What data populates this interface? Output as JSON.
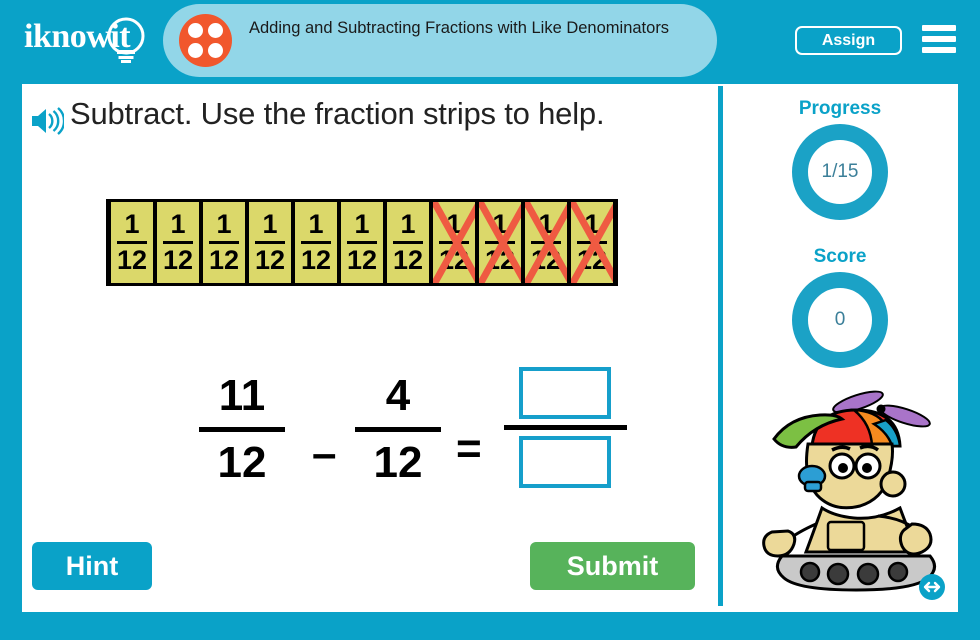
{
  "header": {
    "logo_text": "iknowit",
    "logo_icon": "lightbulb-icon",
    "title": "Adding and Subtracting Fractions with Like Denominators",
    "title_icon": "four-dots-circle-icon",
    "assign_label": "Assign",
    "menu_icon": "hamburger-menu-icon",
    "bg_color": "#0aa2c8",
    "panel_color": "#92d6e8",
    "accent_orange": "#f1572c"
  },
  "main": {
    "audio_icon": "speaker-icon",
    "question": "Subtract. Use the fraction strips to help.",
    "strips": {
      "label_numerator": "1",
      "label_denominator": "12",
      "total": 11,
      "crossed_out": 4,
      "fill_color": "#dbd86a",
      "cross_color": "#ef5a42"
    },
    "equation": {
      "first": {
        "numerator": "11",
        "denominator": "12"
      },
      "operator": "–",
      "second": {
        "numerator": "4",
        "denominator": "12"
      },
      "equals": "=",
      "answer": {
        "numerator": "",
        "denominator": ""
      },
      "answer_border_color": "#169fcb"
    },
    "hint_label": "Hint",
    "submit_label": "Submit",
    "hint_color": "#0aa2c8",
    "submit_color": "#57b35b"
  },
  "sidebar": {
    "progress_label": "Progress",
    "progress_value": "1/15",
    "score_label": "Score",
    "score_value": "0",
    "ring_color": "#1ba2c6",
    "mascot_icon": "robot-propeller-hat-mascot",
    "resize_icon": "resize-horizontal-icon"
  }
}
